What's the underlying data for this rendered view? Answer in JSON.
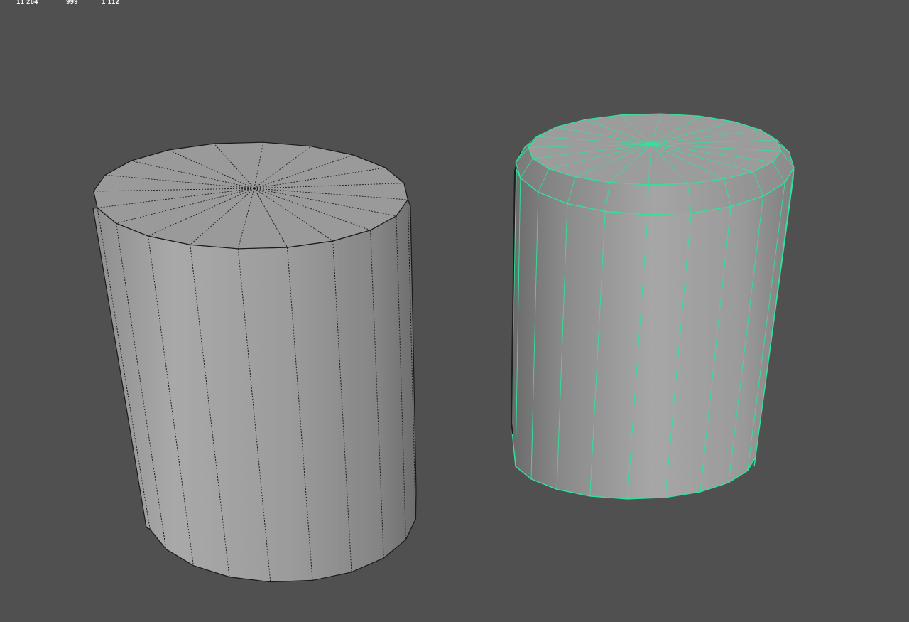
{
  "hud": {
    "stats": [
      "11 264",
      "999",
      "1 112"
    ]
  },
  "colors": {
    "viewport_background": "#505050",
    "mesh_wire": "#1a1a1a",
    "selection_wire": "#2fe39a",
    "hud_text": "#f2f2f2"
  },
  "scene": {
    "objects": [
      {
        "name": "cylinder",
        "selected": false,
        "sides": 20
      },
      {
        "name": "cylinder-beveled",
        "selected": true,
        "sides": 20
      }
    ]
  }
}
